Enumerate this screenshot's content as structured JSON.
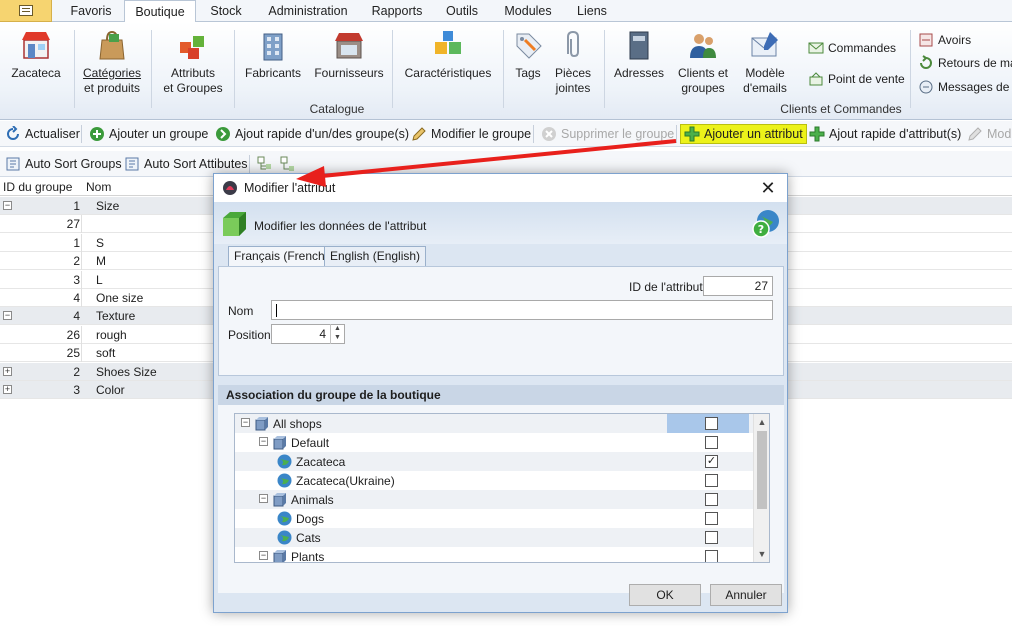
{
  "menu_tabs": [
    "Favoris",
    "Boutique",
    "Stock",
    "Administration",
    "Rapports",
    "Outils",
    "Modules",
    "Liens"
  ],
  "active_tab": "Boutique",
  "ribbon": {
    "zacateca": "Zacateca",
    "categories": [
      "Catégories",
      "et produits"
    ],
    "attributs": [
      "Attributs",
      "et Groupes"
    ],
    "fabricants": "Fabricants",
    "fournisseurs": "Fournisseurs",
    "caracteristiques": "Caractéristiques",
    "tags": "Tags",
    "pieces": [
      "Pièces",
      "jointes"
    ],
    "adresses": "Adresses",
    "clients": [
      "Clients et",
      "groupes"
    ],
    "modele": [
      "Modèle",
      "d'emails"
    ],
    "commandes": "Commandes",
    "point_de_vente": "Point de vente",
    "avoirs": "Avoirs",
    "retours": "Retours de ma",
    "messages": "Messages de c",
    "group_catalogue": "Catalogue",
    "group_clients": "Clients et Commandes"
  },
  "toolbar1": {
    "actualiser": "Actualiser",
    "ajouter_groupe": "Ajouter un groupe",
    "ajout_rapide_groupes": "Ajout rapide d'un/des groupe(s)",
    "modifier_groupe": "Modifier le groupe",
    "supprimer_groupe": "Supprimer le groupe",
    "ajouter_attribut": "Ajouter un attribut",
    "ajout_rapide_attributs": "Ajout rapide d'attribut(s)",
    "modifier_cut": "Mod"
  },
  "toolbar2": {
    "auto_sort_groups": "Auto Sort Groups",
    "auto_sort_attributes": "Auto Sort Attibutes"
  },
  "grid": {
    "headers": {
      "id": "ID du groupe",
      "name": "Nom"
    },
    "rows": [
      {
        "kind": "group",
        "expander": "⊟",
        "id": "1",
        "name": "Size"
      },
      {
        "kind": "child",
        "id": "27",
        "name": ""
      },
      {
        "kind": "child",
        "id": "1",
        "name": "S"
      },
      {
        "kind": "child",
        "id": "2",
        "name": "M"
      },
      {
        "kind": "child",
        "id": "3",
        "name": "L"
      },
      {
        "kind": "child",
        "id": "4",
        "name": "One size"
      },
      {
        "kind": "group",
        "expander": "⊟",
        "id": "4",
        "name": "Texture"
      },
      {
        "kind": "child",
        "id": "26",
        "name": "rough"
      },
      {
        "kind": "child",
        "id": "25",
        "name": "soft"
      },
      {
        "kind": "group",
        "expander": "⊞",
        "id": "2",
        "name": "Shoes Size"
      },
      {
        "kind": "group",
        "expander": "⊞",
        "id": "3",
        "name": "Color"
      }
    ]
  },
  "dialog": {
    "title": "Modifier l'attribut",
    "header_text": "Modifier les données de l'attribut",
    "tabs": [
      "Français (French)",
      "English (English)"
    ],
    "id_label": "ID de l'attribut",
    "id_value": "27",
    "name_label": "Nom",
    "name_value": "",
    "position_label": "Position",
    "position_value": "4",
    "assoc_title": "Association du groupe de la boutique",
    "shops": [
      {
        "label": "All shops",
        "checked": false
      },
      {
        "label": "Default",
        "checked": false
      },
      {
        "label": "Zacateca",
        "checked": true
      },
      {
        "label": "Zacateca(Ukraine)",
        "checked": false
      },
      {
        "label": "Animals",
        "checked": false
      },
      {
        "label": "Dogs",
        "checked": false
      },
      {
        "label": "Cats",
        "checked": false
      },
      {
        "label": "Plants",
        "checked": false
      }
    ],
    "ok": "OK",
    "cancel": "Annuler",
    "close_glyph": "✕",
    "check_glyph": "✓"
  },
  "colors": {
    "highlight": "#ecf21a",
    "arrow": "#e8201c",
    "selection": "#a9c7ea"
  }
}
